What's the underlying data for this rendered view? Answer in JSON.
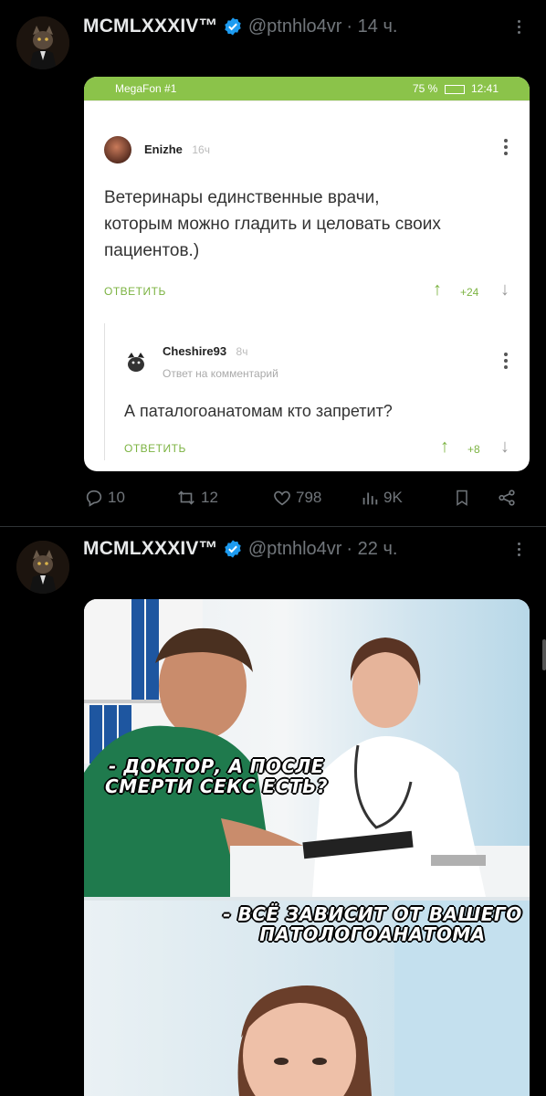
{
  "posts": [
    {
      "author_name": "MCMLXXXIV™",
      "handle": "@ptnhlo4vr",
      "time": "· 14 ч.",
      "embedded": {
        "status_left": "MegaFon #1",
        "status_battery": "75 %",
        "status_time": "12:41",
        "comment1": {
          "author": "Enizhe",
          "time": "16ч",
          "text_line1": "Ветеринары единственные врачи,",
          "text_line2": "которым можно гладить и целовать своих",
          "text_line3": "пациентов.)",
          "reply_label": "ОТВЕТИТЬ",
          "score": "+24"
        },
        "comment2": {
          "author": "Cheshire93",
          "time": "8ч",
          "reply_to": "Ответ на комментарий",
          "text": "А паталогоанатомам кто запретит?",
          "reply_label": "ОТВЕТИТЬ",
          "score": "+8"
        }
      },
      "stats": {
        "replies": "10",
        "reposts": "12",
        "likes": "798",
        "views": "9K"
      }
    },
    {
      "author_name": "MCMLXXXIV™",
      "handle": "@ptnhlo4vr",
      "time": "· 22 ч.",
      "meme": {
        "caption1_line1": "- ДОКТОР, А ПОСЛЕ",
        "caption1_line2": "СМЕРТИ СЕКС ЕСТЬ?",
        "caption2_line1": "- ВСЁ ЗАВИСИТ ОТ ВАШЕГО",
        "caption2_line2": "ПАТОЛОГОАНАТОМА"
      }
    }
  ],
  "colors": {
    "background": "#000000",
    "verified": "#1d9bf0",
    "muted": "#71767b",
    "pikabu_green": "#8bc34a"
  },
  "icons": [
    "verified-icon",
    "more-icon",
    "reply-icon",
    "repost-icon",
    "like-icon",
    "views-icon",
    "bookmark-icon",
    "share-icon"
  ]
}
